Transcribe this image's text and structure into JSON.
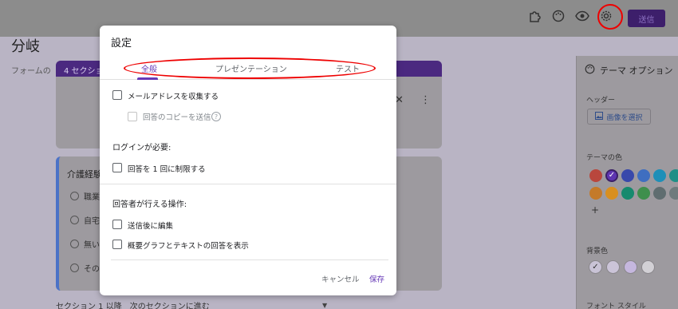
{
  "toolbar": {
    "send_label": "送信",
    "icons": [
      "puzzle-icon",
      "palette-icon",
      "eye-icon",
      "gear-icon"
    ]
  },
  "form": {
    "section_badge": "4 セクション",
    "title": "分岐",
    "description": "フォームの",
    "question_title": "介護経験",
    "options": [
      "職業",
      "自宅",
      "無い",
      "その他"
    ],
    "section_nav": "セクション 1 以降　次のセクションに進む"
  },
  "theme_panel": {
    "title": "テーマ オプション",
    "header_label": "ヘッダー",
    "select_image_label": "画像を選択",
    "theme_color_label": "テーマの色",
    "theme_colors": [
      "#b9473d",
      "#5e35b1",
      "#3949ab",
      "#3f6ec0",
      "#1e8fb8",
      "#1e8f86",
      "#c47a2a",
      "#d88f1f",
      "#168a6e",
      "#3f8f4d",
      "#5f6d70",
      "#6e7b7d"
    ],
    "add_label": "+",
    "bg_color_label": "背景色",
    "bg_colors": [
      "#c9c3d6",
      "#cbc4d8",
      "#c5b7de",
      "#d2d0d5"
    ],
    "font_style_label": "フォント スタイル"
  },
  "modal": {
    "title": "設定",
    "tabs": [
      "全般",
      "プレゼンテーション",
      "テスト"
    ],
    "active_tab": "全般",
    "collect_email": "メールアドレスを収集する",
    "send_copy": "回答のコピーを送信",
    "login_required": "ログインが必要:",
    "limit_one": "回答を 1 回に制限する",
    "respondent_actions": "回答者が行える操作:",
    "edit_after_submit": "送信後に編集",
    "show_summary": "概要グラフとテキストの回答を表示",
    "cancel": "キャンセル",
    "save": "保存"
  },
  "colors": {
    "accent": "#673ab7",
    "annotation": "#e00000"
  }
}
